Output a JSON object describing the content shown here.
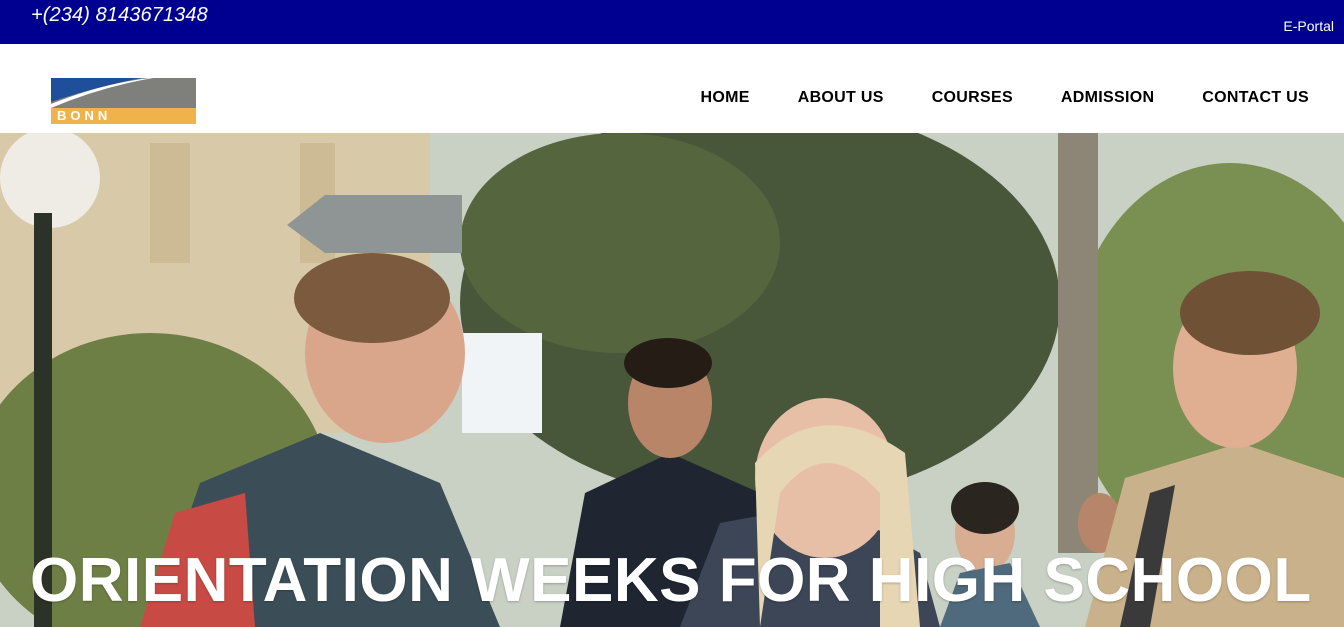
{
  "topbar": {
    "phone": "+(234) 8143671348",
    "portal_link": "E-Portal",
    "bg_color": "#000090"
  },
  "header": {
    "logo_text": "BONN",
    "nav": [
      {
        "label": "HOME"
      },
      {
        "label": "ABOUT US"
      },
      {
        "label": "COURSES"
      },
      {
        "label": "ADMISSION"
      },
      {
        "label": "CONTACT US"
      }
    ]
  },
  "hero": {
    "title": "ORIENTATION WEEKS FOR HIGH SCHOOL",
    "image": "students-walking-photo"
  }
}
